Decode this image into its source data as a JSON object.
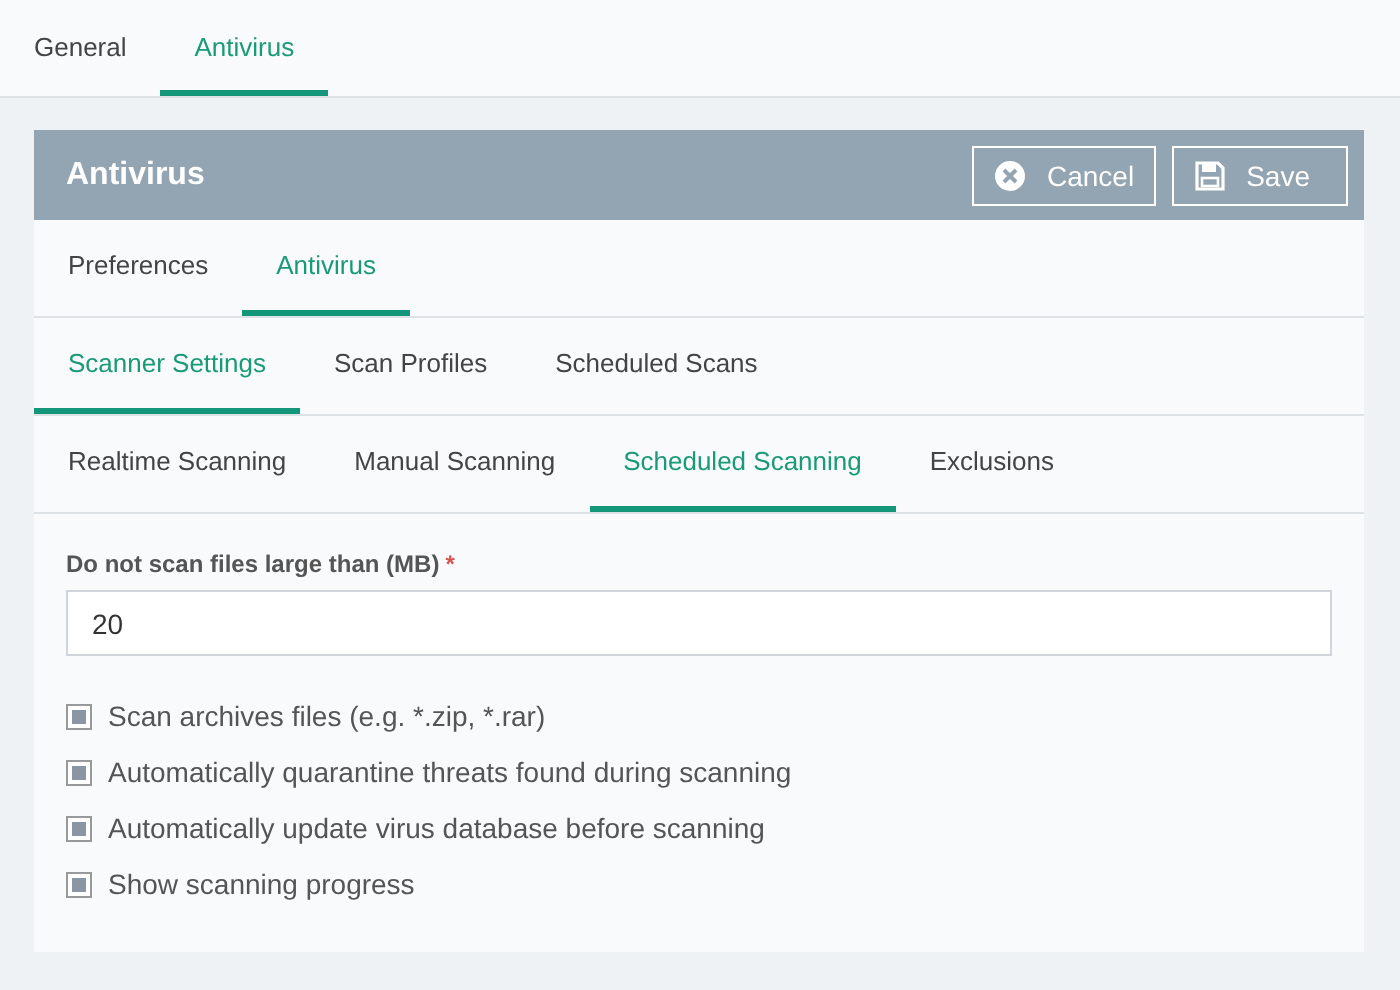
{
  "top_tabs": [
    {
      "label": "General",
      "selected": false
    },
    {
      "label": "Antivirus",
      "selected": true
    }
  ],
  "panel": {
    "title": "Antivirus",
    "buttons": [
      {
        "kind": "cancel",
        "label": "Cancel"
      },
      {
        "kind": "save",
        "label": "Save"
      }
    ]
  },
  "section_tabs": [
    {
      "label": "Preferences",
      "selected": false
    },
    {
      "label": "Antivirus",
      "selected": true
    }
  ],
  "scanner_tabs": [
    {
      "label": "Scanner Settings",
      "selected": true
    },
    {
      "label": "Scan Profiles",
      "selected": false
    },
    {
      "label": "Scheduled Scans",
      "selected": false
    }
  ],
  "scan_tabs": [
    {
      "label": "Realtime Scanning",
      "selected": false
    },
    {
      "label": "Manual Scanning",
      "selected": false
    },
    {
      "label": "Scheduled Scanning",
      "selected": true
    },
    {
      "label": "Exclusions",
      "selected": false
    }
  ],
  "size_field": {
    "label": "Do not scan files large than (MB)",
    "required_mark": "*",
    "value": "20"
  },
  "options": [
    {
      "label": "Scan archives files (e.g. *.zip, *.rar)",
      "checked": true
    },
    {
      "label": "Automatically quarantine threats found during scanning",
      "checked": true
    },
    {
      "label": "Automatically update virus database before scanning",
      "checked": true
    },
    {
      "label": "Show scanning progress",
      "checked": true
    }
  ]
}
